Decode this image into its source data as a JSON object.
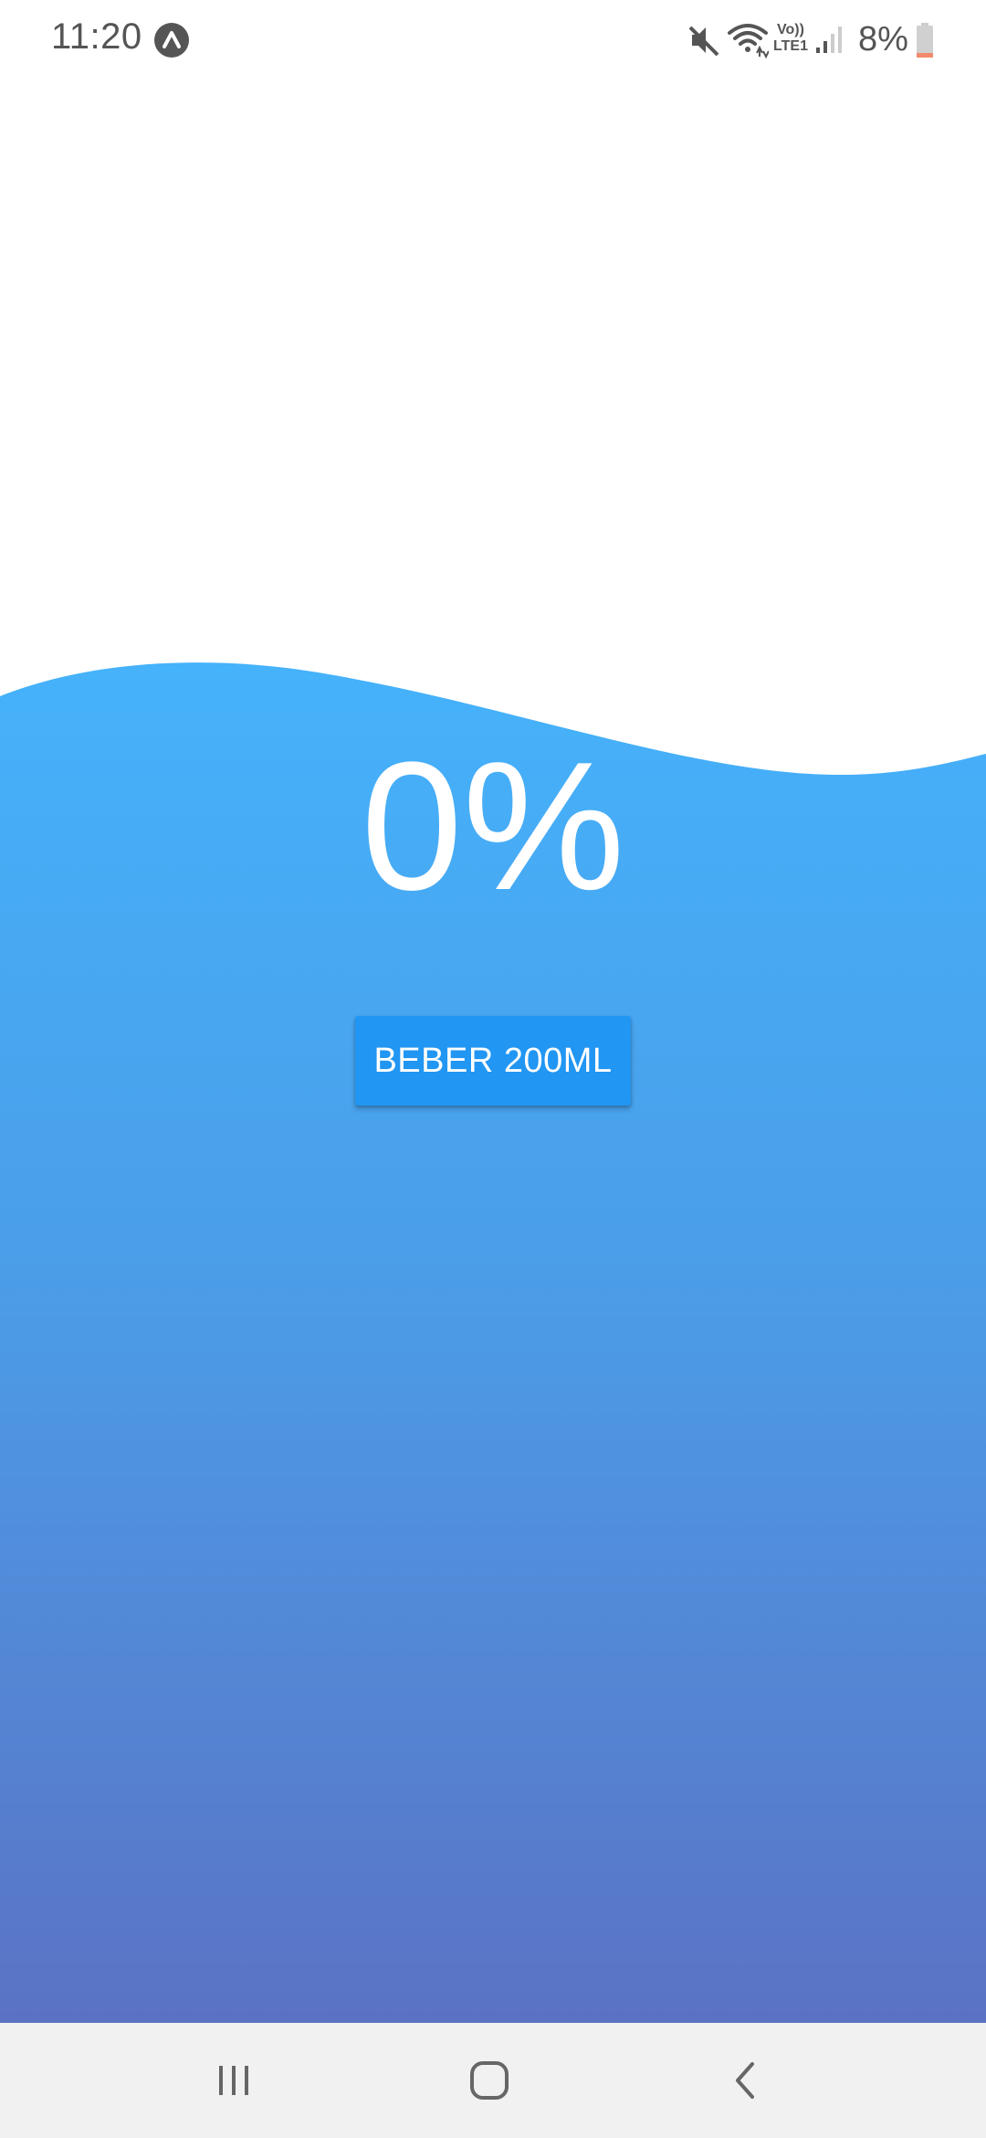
{
  "status_bar": {
    "time": "11:20",
    "battery_percent_text": "8%",
    "battery_level": 0.08,
    "icons": [
      "app-notification-icon",
      "mute-icon",
      "wifi-icon",
      "volte-lte-icon",
      "signal-icon",
      "battery-icon"
    ],
    "volte_line1": "Vo))",
    "volte_line2": "LTE1"
  },
  "water": {
    "progress_text": "0%",
    "progress_value": 0,
    "drink_button_label": "BEBER 200ML",
    "colors": {
      "wave_top": "#45b2fb",
      "wave_bottom": "#5b72c4",
      "button": "#2196f3",
      "background": "#ffffff"
    }
  },
  "nav_bar": {
    "recents_icon": "recents-icon",
    "home_icon": "home-icon",
    "back_icon": "back-icon"
  }
}
